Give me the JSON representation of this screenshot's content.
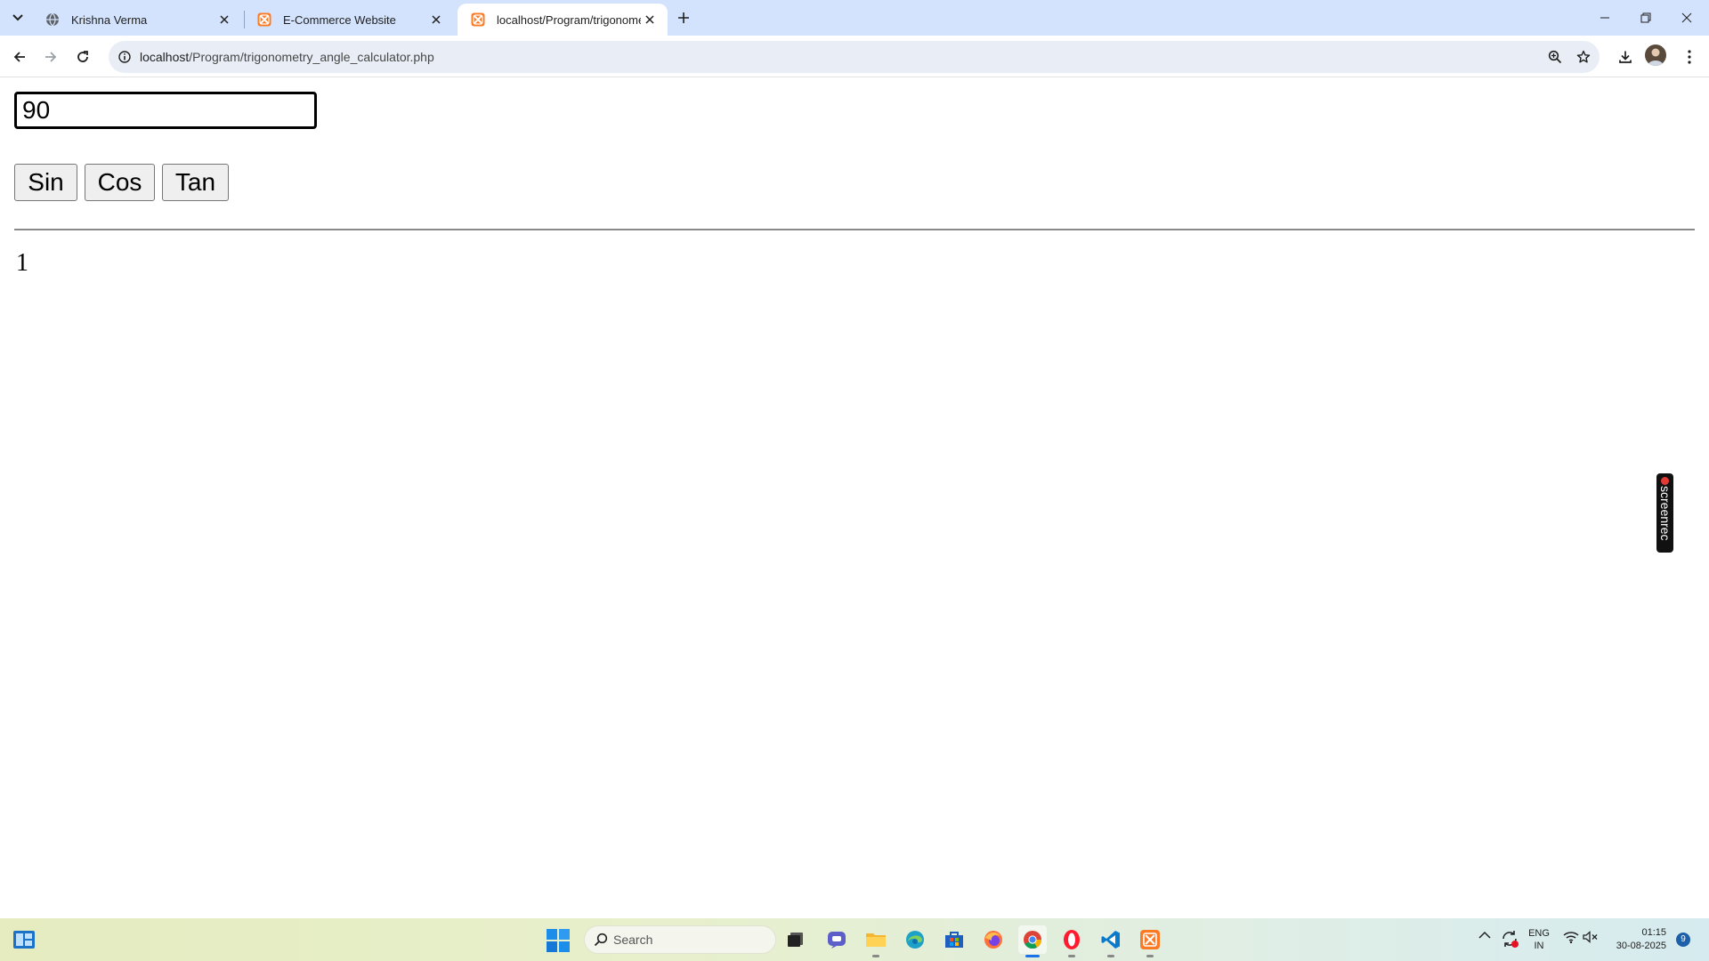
{
  "browser": {
    "tabs": [
      {
        "title": "Krishna Verma",
        "favicon": "globe-icon",
        "active": false
      },
      {
        "title": "E-Commerce Website",
        "favicon": "xampp-icon",
        "active": false
      },
      {
        "title": "localhost/Program/trigonometry_angle_calculator.php",
        "favicon": "xampp-icon",
        "active": true
      }
    ],
    "url_host": "localhost",
    "url_path": "/Program/trigonometry_angle_calculator.php"
  },
  "page": {
    "angle_value": "90",
    "buttons": {
      "sin": "Sin",
      "cos": "Cos",
      "tan": "Tan"
    },
    "result": "1",
    "overlay_label": "screenrec"
  },
  "taskbar": {
    "search_label": "Search",
    "lang_line1": "ENG",
    "lang_line2": "IN",
    "time": "01:15",
    "date": "30-08-2025",
    "notification_count": "9",
    "apps": [
      "task-view-icon",
      "teams-icon",
      "file-explorer-icon",
      "edge-icon",
      "store-icon",
      "firefox-icon",
      "chrome-icon",
      "opera-icon",
      "vscode-icon",
      "xampp-icon"
    ]
  },
  "colors": {
    "tabstrip_bg": "#d3e3fd",
    "omnibox_bg": "#e9eef6",
    "accent": "#1a73e8"
  }
}
